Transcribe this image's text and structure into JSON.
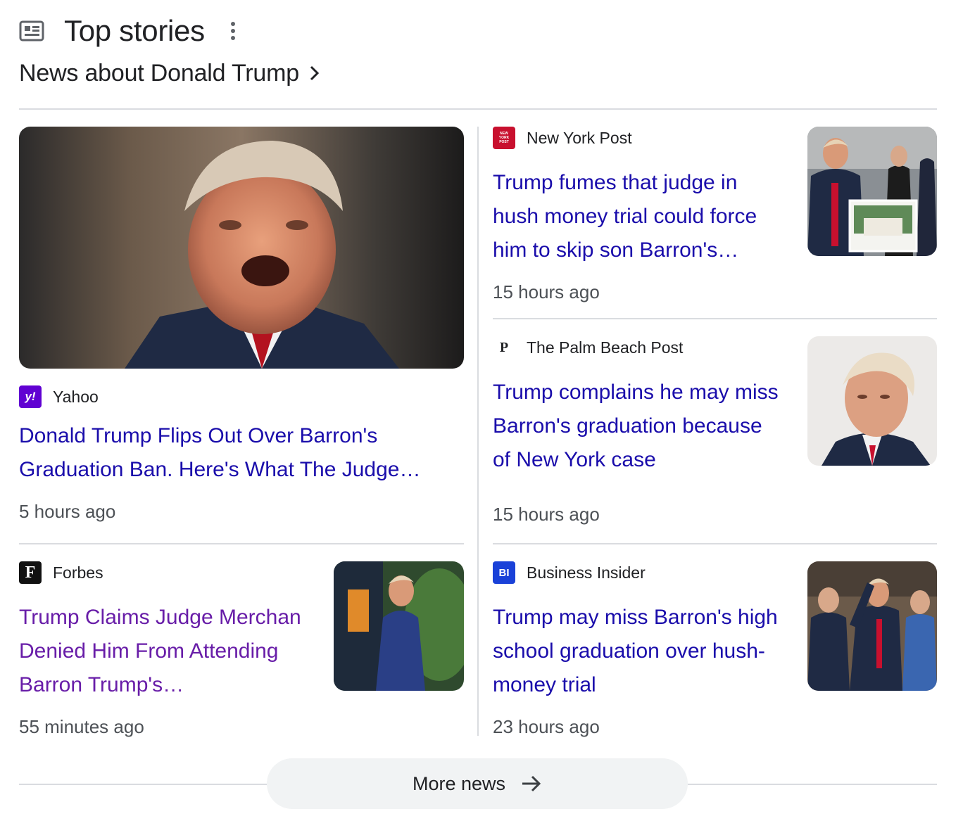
{
  "header": {
    "title": "Top stories",
    "subtitle": "News about Donald Trump"
  },
  "stories": [
    {
      "source": "Yahoo",
      "logo_text": "y!",
      "logo_color": "#6001d2",
      "headline": "Donald Trump Flips Out Over Barron's Graduation Ban. Here's What The Judge…",
      "time": "5 hours ago"
    },
    {
      "source": "Forbes",
      "logo_text": "F",
      "logo_color": "#111111",
      "headline": "Trump Claims Judge Merchan Denied Him From Attending Barron Trump's…",
      "time": "55 minutes ago",
      "visited": true
    },
    {
      "source": "New York Post",
      "logo_text": "NEW YORK POST",
      "logo_color": "#c8102e",
      "headline": "Trump fumes that judge in hush money trial could force him to skip son Barron's…",
      "time": "15 hours ago"
    },
    {
      "source": "The Palm Beach Post",
      "logo_text": "P",
      "logo_color": "#ffffff",
      "headline": "Trump complains he may miss Barron's graduation because of New York case",
      "time": "15 hours ago"
    },
    {
      "source": "Business Insider",
      "logo_text": "BI",
      "logo_color": "#1a41d8",
      "headline": "Trump may miss Barron's high school graduation over hush-money trial",
      "time": "23 hours ago"
    }
  ],
  "more_news": {
    "label": "More news"
  },
  "icons": {
    "header": "newspaper-icon",
    "menu": "more-vert-icon",
    "subtitle_chevron": "chevron-right-icon",
    "more_arrow": "arrow-right-icon"
  },
  "colors": {
    "link": "#1a0dab",
    "visited_link": "#681da8",
    "divider": "#dadce0",
    "button_bg": "#f1f3f4"
  }
}
